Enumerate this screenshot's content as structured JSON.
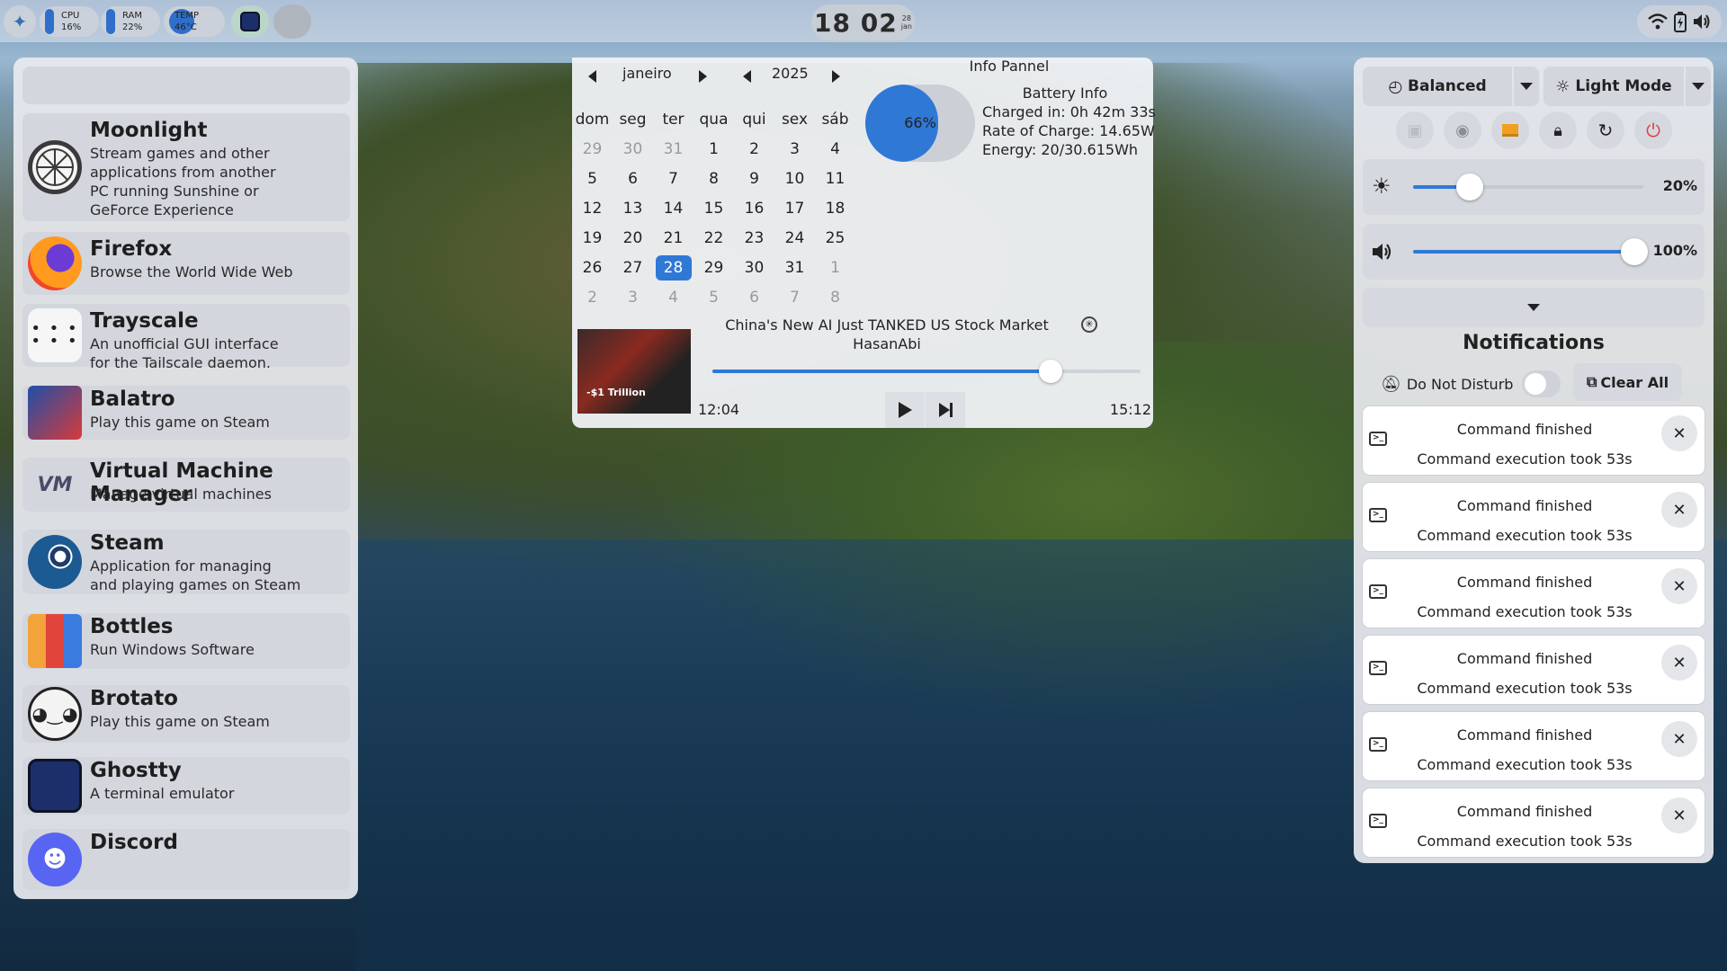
{
  "topbar": {
    "cpu_label": "CPU",
    "cpu_value": "16%",
    "ram_label": "RAM",
    "ram_value": "22%",
    "temp_label": "TEMP",
    "temp_value": "46°C",
    "clock_time": "18 02",
    "clock_day": "28",
    "clock_month": "jan"
  },
  "launcher": {
    "apps": [
      {
        "name": "Moonlight",
        "desc": "Stream games and other\napplications from another\nPC running Sunshine or\nGeForce Experience",
        "icon": "moonlight-icon"
      },
      {
        "name": "Firefox",
        "desc": "Browse the World Wide Web",
        "icon": "firefox-icon"
      },
      {
        "name": "Trayscale",
        "desc": "An unofficial GUI interface\nfor the Tailscale daemon.",
        "icon": "trayscale-icon"
      },
      {
        "name": "Balatro",
        "desc": "Play this game on Steam",
        "icon": "balatro-icon"
      },
      {
        "name": "Virtual Machine Manager",
        "desc": "Manage virtual machines",
        "icon": "virt-manager-icon"
      },
      {
        "name": "Steam",
        "desc": "Application for managing\nand playing games on Steam",
        "icon": "steam-icon"
      },
      {
        "name": "Bottles",
        "desc": "Run Windows Software",
        "icon": "bottles-icon"
      },
      {
        "name": "Brotato",
        "desc": "Play this game on Steam",
        "icon": "brotato-icon"
      },
      {
        "name": "Ghostty",
        "desc": "A terminal emulator",
        "icon": "ghostty-icon"
      },
      {
        "name": "Discord",
        "desc": "",
        "icon": "discord-icon"
      }
    ]
  },
  "calendar": {
    "month": "janeiro",
    "year": "2025",
    "weekdays": [
      "dom",
      "seg",
      "ter",
      "qua",
      "qui",
      "sex",
      "sáb"
    ],
    "weeks": [
      [
        "29",
        "30",
        "31",
        "1",
        "2",
        "3",
        "4"
      ],
      [
        "5",
        "6",
        "7",
        "8",
        "9",
        "10",
        "11"
      ],
      [
        "12",
        "13",
        "14",
        "15",
        "16",
        "17",
        "18"
      ],
      [
        "19",
        "20",
        "21",
        "22",
        "23",
        "24",
        "25"
      ],
      [
        "26",
        "27",
        "28",
        "29",
        "30",
        "31",
        "1"
      ],
      [
        "2",
        "3",
        "4",
        "5",
        "6",
        "7",
        "8"
      ]
    ],
    "selected_day": "28"
  },
  "info_panel": {
    "title": "Info Pannel",
    "battery_heading": "Battery Info",
    "battery_percent": "66%",
    "battery_level": 0.66,
    "charged_in": "Charged in: 0h 42m 33s",
    "rate": "Rate of Charge: 14.65W",
    "energy": "Energy: 20/30.615Wh"
  },
  "media": {
    "title": "China's New AI Just TANKED US Stock Market",
    "artist": "HasanAbi",
    "thumb_caption": "-$1 Trillion",
    "position": "12:04",
    "length": "15:12",
    "progress": 0.79
  },
  "control_center": {
    "power_profile": "Balanced",
    "theme_mode": "Light Mode",
    "brightness": "20%",
    "brightness_level": 0.2,
    "volume": "100%",
    "volume_level": 1.0,
    "notifications_title": "Notifications",
    "dnd_label": "Do Not Disturb",
    "clear_all": "Clear All",
    "notifications": [
      {
        "title": "Command finished",
        "body": "Command execution took 53s"
      },
      {
        "title": "Command finished",
        "body": "Command execution took 53s"
      },
      {
        "title": "Command finished",
        "body": "Command execution took 53s"
      },
      {
        "title": "Command finished",
        "body": "Command execution took 53s"
      },
      {
        "title": "Command finished",
        "body": "Command execution took 53s"
      },
      {
        "title": "Command finished",
        "body": "Command execution took 53s"
      }
    ]
  },
  "colors": {
    "accent": "#2f78d6",
    "power": "#e23b3b",
    "battery_fill": "#2f78d6"
  }
}
